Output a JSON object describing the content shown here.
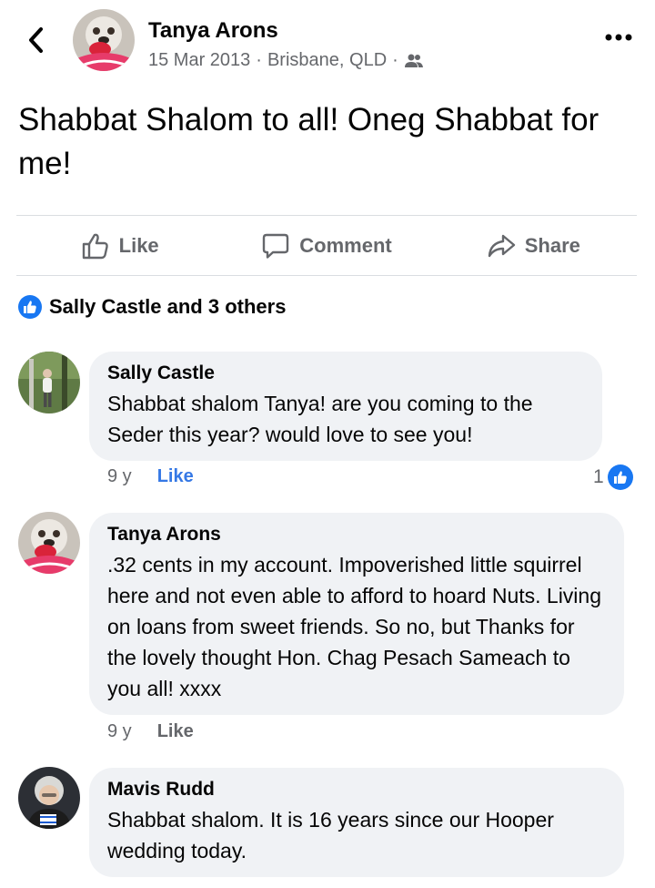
{
  "post": {
    "author": "Tanya Arons",
    "date": "15 Mar 2013",
    "location": "Brisbane, QLD",
    "text": "Shabbat Shalom to all!  Oneg Shabbat for me!"
  },
  "actions": {
    "like": "Like",
    "comment": "Comment",
    "share": "Share"
  },
  "reactions": {
    "summary": "Sally Castle and 3 others"
  },
  "comments": [
    {
      "name": "Sally Castle",
      "text": "Shabbat shalom Tanya! are you coming to the Seder this year? would love to see you!",
      "age": "9 y",
      "like_label": "Like",
      "like_count": "1"
    },
    {
      "name": "Tanya Arons",
      "text": ".32 cents in my account.  Impoverished little squirrel here and not even able to afford to hoard Nuts.  Living on loans from sweet friends. So no, but Thanks for the lovely thought Hon. Chag Pesach Sameach to you all! xxxx",
      "age": "9 y",
      "like_label": "Like"
    },
    {
      "name": "Mavis Rudd",
      "text": "Shabbat shalom. It is 16 years since our Hooper wedding today."
    }
  ],
  "colors": {
    "accent": "#1877f2",
    "secondary_text": "#65676b",
    "bubble": "#f0f2f5"
  }
}
